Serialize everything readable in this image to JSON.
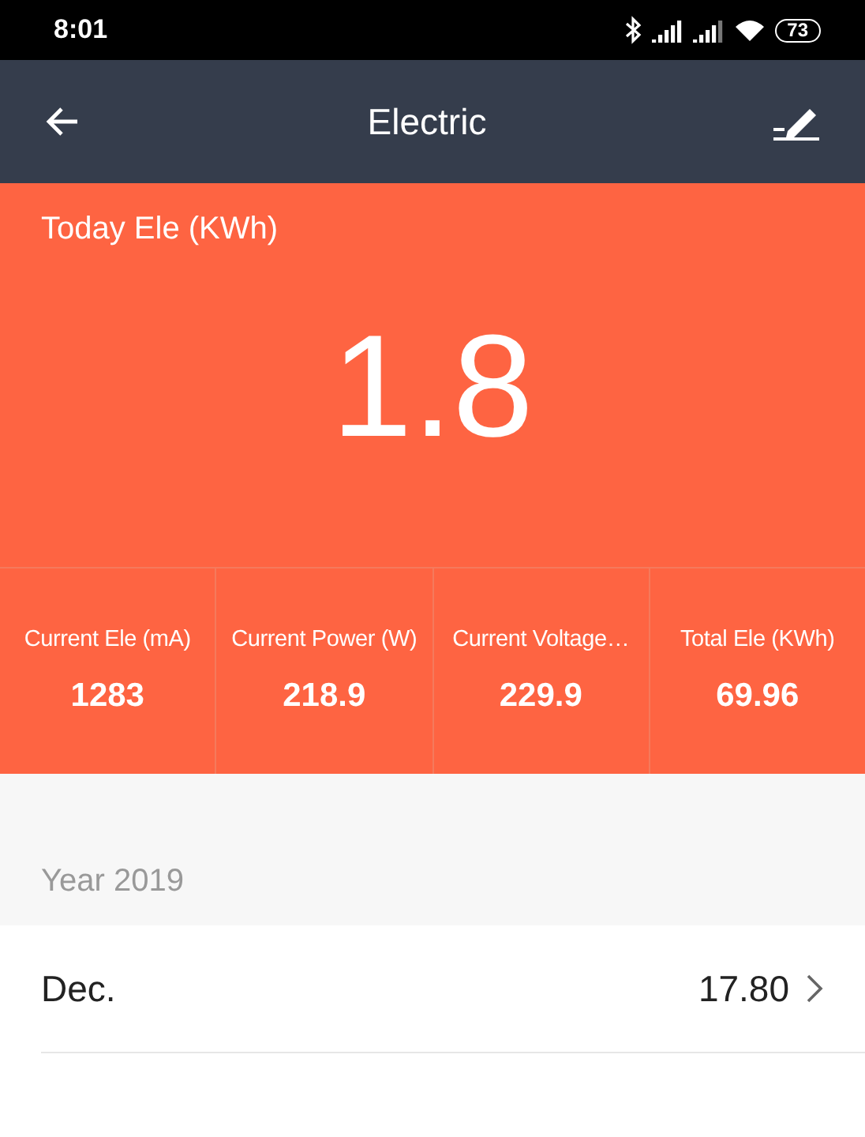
{
  "status_bar": {
    "time": "8:01",
    "battery": "73"
  },
  "header": {
    "title": "Electric"
  },
  "today": {
    "label": "Today Ele (KWh)",
    "value": "1.8"
  },
  "stats": [
    {
      "label": "Current Ele (mA)",
      "value": "1283"
    },
    {
      "label": "Current Power (W)",
      "value": "218.9"
    },
    {
      "label": "Current Voltage…",
      "value": "229.9"
    },
    {
      "label": "Total Ele (KWh)",
      "value": "69.96"
    }
  ],
  "year": {
    "label": "Year 2019"
  },
  "months": [
    {
      "label": "Dec.",
      "value": "17.80"
    }
  ]
}
